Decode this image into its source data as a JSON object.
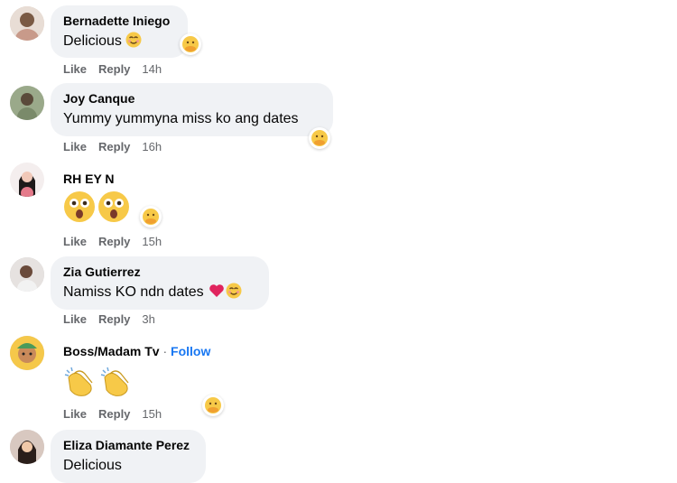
{
  "comments": [
    {
      "author": "Bernadette Iniego",
      "text": "Delicious",
      "actions": {
        "like": "Like",
        "reply": "Reply",
        "time": "14h"
      },
      "inline_emoji": "smiling-face-icon",
      "reaction": "care-reaction-icon"
    },
    {
      "author": "Joy Canque",
      "text": "Yummy yummyna miss ko ang dates",
      "actions": {
        "like": "Like",
        "reply": "Reply",
        "time": "16h"
      },
      "reaction": "care-reaction-icon"
    },
    {
      "author": "RH EY N",
      "emojis": [
        "astonished-face-icon",
        "astonished-face-icon"
      ],
      "actions": {
        "like": "Like",
        "reply": "Reply",
        "time": "15h"
      },
      "reaction": "care-reaction-icon"
    },
    {
      "author": "Zia Gutierrez",
      "text": "Namiss KO ndn dates",
      "inline_emojis": [
        "red-heart-icon",
        "smiling-face-icon"
      ],
      "actions": {
        "like": "Like",
        "reply": "Reply",
        "time": "3h"
      }
    },
    {
      "author": "Boss/Madam Tv",
      "separator": "·",
      "follow": "Follow",
      "emojis": [
        "clapping-hands-icon",
        "clapping-hands-icon"
      ],
      "actions": {
        "like": "Like",
        "reply": "Reply",
        "time": "15h"
      },
      "reaction": "care-reaction-icon"
    },
    {
      "author": "Eliza Diamante Perez",
      "text": "Delicious"
    }
  ],
  "colors": {
    "bubble": "#f0f2f5",
    "meta": "#65676b",
    "link": "#1877f2"
  }
}
